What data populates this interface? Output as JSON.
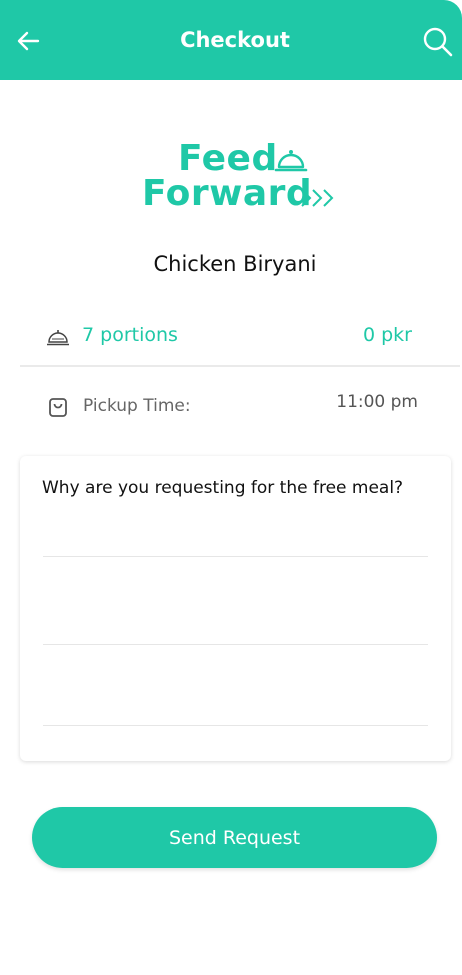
{
  "header": {
    "title": "Checkout",
    "back_icon": "arrow-left-icon",
    "search_icon": "search-icon",
    "background": "#1fc8a7"
  },
  "logo": {
    "line1": "Feed",
    "line2": "Forward",
    "icons": [
      "cloche-icon",
      "chevrons-icon"
    ]
  },
  "item": {
    "name": "Chicken Biryani",
    "portions": "7 portions",
    "price": "0 pkr",
    "portion_icon": "cloche-icon",
    "pickup_icon": "shopping-bag-icon",
    "pickup_label": "Pickup Time:",
    "pickup_time": "11:00 pm"
  },
  "reason": {
    "question": "Why are you requesting for the free meal?",
    "value": ""
  },
  "actions": {
    "send_label": "Send Request"
  },
  "colors": {
    "accent": "#1fc8a7",
    "muted_text": "#666666"
  }
}
